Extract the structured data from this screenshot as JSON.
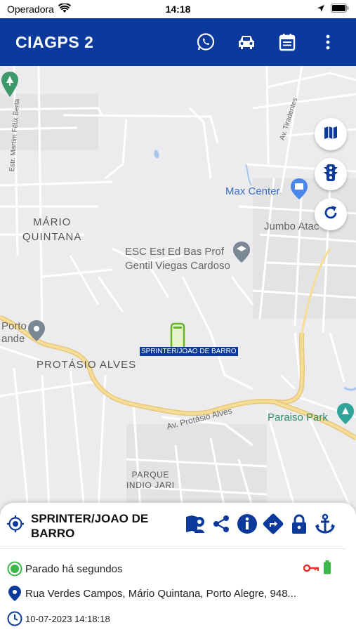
{
  "status_bar": {
    "carrier": "Operadora",
    "time": "14:18"
  },
  "app_bar": {
    "title": "CIAGPS 2",
    "icons": [
      "whatsapp-icon",
      "car-icon",
      "calendar-icon",
      "more-vert-icon"
    ],
    "background": "#0b3a9c"
  },
  "map": {
    "labels": {
      "mario_quintana_1": "MÁRIO",
      "mario_quintana_2": "QUINTANA",
      "protasio_alves": "PROTÁSIO ALVES",
      "parque_indio_jari_1": "PARQUE",
      "parque_indio_jari_2": "INDIO JARI",
      "max_center": "Max Center",
      "jumbo": "Jumbo Atac",
      "esc_1": "ESC Est Ed Bas Prof",
      "esc_2": "Gentil Viegas Cardoso",
      "porto_1": "Porto",
      "porto_2": "ande",
      "paraiso_park": "Paraiso Park",
      "av_protasio_alves": "Av. Protásio Alves",
      "estr_martim": "Estr. Martim Félix Berta",
      "av_tiradentes": "Av. Tiradentes"
    },
    "vehicle_label": "SPRINTER/JOAO DE BARRO",
    "controls": [
      "map-layers-icon",
      "traffic-light-icon",
      "refresh-icon"
    ]
  },
  "sheet": {
    "vehicle_name": "SPRINTER/JOAO DE BARRO",
    "actions": [
      "geofence-icon",
      "share-icon",
      "info-icon",
      "directions-icon",
      "lock-icon",
      "anchor-icon"
    ],
    "status_text": "Parado há segundos",
    "address": "Rua Verdes Campos, Mário Quintana, Porto Alegre, 948...",
    "timestamp": "10-07-2023 14:18:18",
    "colors": {
      "accent": "#0b3a9c",
      "status_green": "#3cb84a",
      "key_red": "#e0312b",
      "battery_green": "#3cb84a"
    }
  }
}
